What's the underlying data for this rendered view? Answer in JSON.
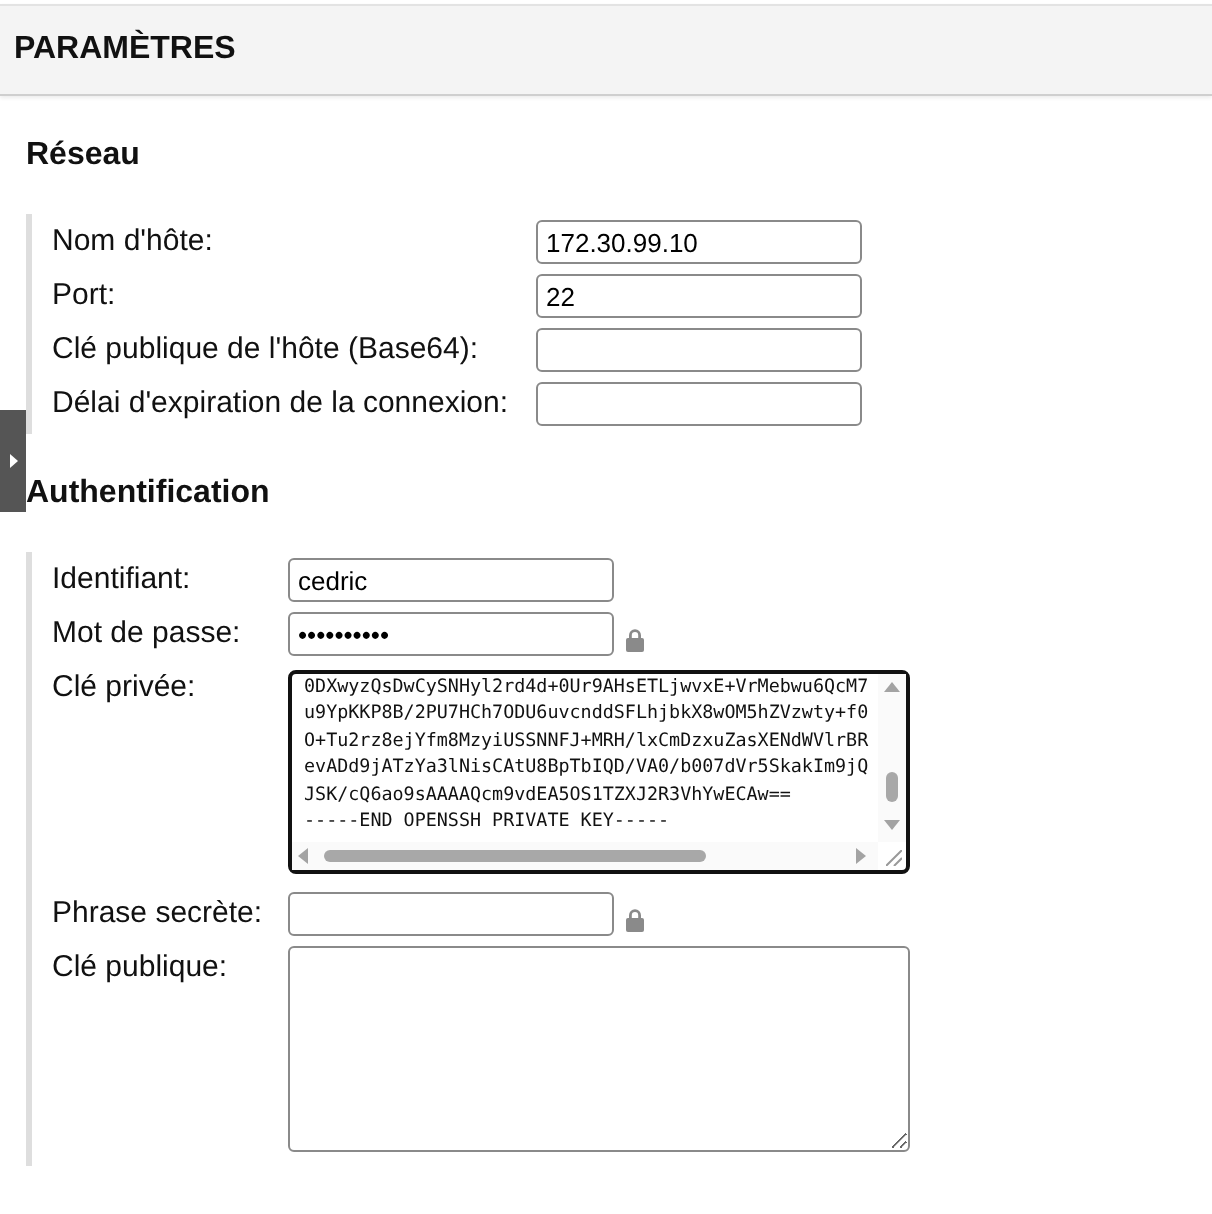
{
  "header": {
    "title": "PARAMÈTRES"
  },
  "sections": [
    {
      "title": "Réseau",
      "fields": [
        {
          "kind": "text",
          "label": "Nom d'hôte:",
          "value": "172.30.99.10",
          "focused": false
        },
        {
          "kind": "text",
          "label": "Port:",
          "value": "22",
          "focused": false
        },
        {
          "kind": "text",
          "label": "Clé publique de l'hôte (Base64):",
          "focused": false
        },
        {
          "kind": "text",
          "label": "Délai d'expiration de la connexion:",
          "focused": false
        }
      ]
    },
    {
      "title": "Authentification",
      "fields": [
        {
          "kind": "text",
          "label": "Identifiant:",
          "value": "cedric",
          "focused": false
        },
        {
          "kind": "secret",
          "label": "Mot de passe:",
          "value": "••••••••••",
          "focused": false
        },
        {
          "kind": "key",
          "label": "Clé privée:",
          "focused": true,
          "value": "0DXwyzQsDwCySNHyl2rd4d+0Ur9AHsETLjwvxE+VrMebwu6QcM7\nu9YpKKP8B/2PU7HCh7ODU6uvcnddSFLhjbkX8wOM5hZVzwty+f0\nO+Tu2rz8ejYfm8MzyiUSSNNFJ+MRH/lxCmDzxuZasXENdWVlrBR\nevADd9jATzYa3lNisCAtU8BpTbIQD/VA0/b007dVr5SkakIm9jQ\nJSK/cQ6ao9sAAAAQcm9vdEA5OS1TZXJ2R3VhYwECAw==\n-----END OPENSSH PRIVATE KEY-----"
        },
        {
          "kind": "secret",
          "label": "Phrase secrète:",
          "focused": false
        },
        {
          "kind": "textarea",
          "label": "Clé publique:",
          "focused": false
        }
      ]
    }
  ]
}
